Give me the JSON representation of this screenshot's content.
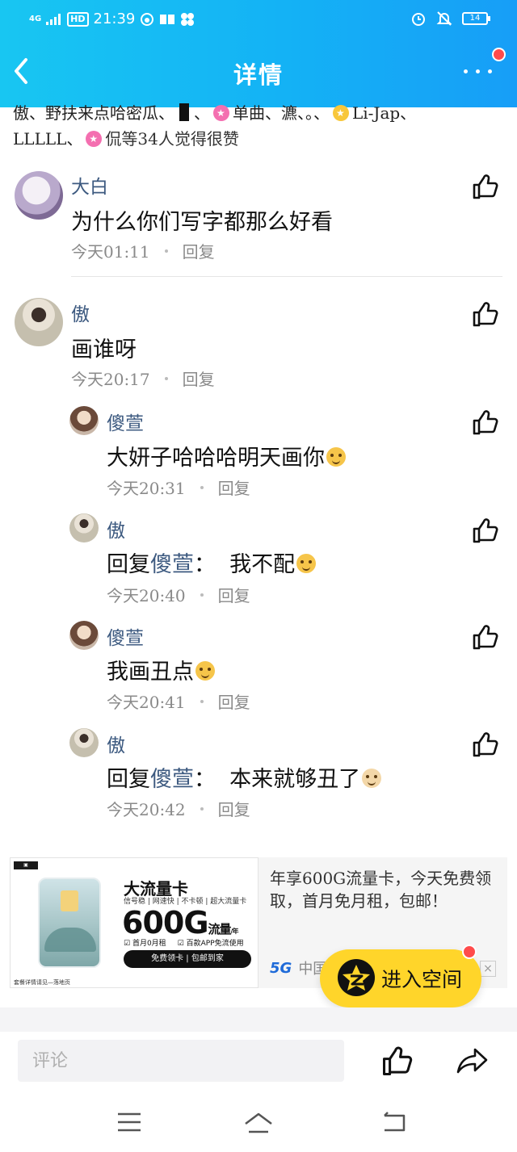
{
  "status_bar": {
    "network": "4G",
    "hd": "HD",
    "time": "21:39",
    "battery": "14"
  },
  "nav": {
    "title": "详情"
  },
  "likes": {
    "names": [
      "傲",
      "野扶来点哈密瓜",
      "",
      "单曲",
      "瀌",
      "。",
      "Li-Jap",
      "LLLLL",
      "侃"
    ],
    "line1": "傲、野扶来点哈密瓜、",
    "seg2": "、",
    "seg3": "单曲、瀌、。、",
    "seg4": "Li-Jap、",
    "line2_start": "LLLLL、",
    "summary": "侃等34人觉得很赞"
  },
  "comments": [
    {
      "name": "大白",
      "text": "为什么你们写字都那么好看",
      "time": "今天01:11",
      "reply_label": "回复",
      "avatar_color": "#d9cde6"
    },
    {
      "name": "傲",
      "text": "画谁呀",
      "time": "今天20:17",
      "reply_label": "回复",
      "avatar_color": "#c9c4b8"
    }
  ],
  "replies": [
    {
      "name": "傻萱",
      "text": "大妍子哈哈哈明天画你",
      "emoji": "dog-face-emoji",
      "time": "今天20:31",
      "reply_label": "回复"
    },
    {
      "name": "傲",
      "reply_prefix": "回复",
      "reply_to": "傻萱",
      "reply_colon": "：",
      "text": "我不配",
      "emoji": "dog-face-emoji",
      "time": "今天20:40",
      "reply_label": "回复"
    },
    {
      "name": "傻萱",
      "text": "我画丑点",
      "emoji": "dog-face-emoji",
      "time": "今天20:41",
      "reply_label": "回复"
    },
    {
      "name": "傲",
      "reply_prefix": "回复",
      "reply_to": "傻萱",
      "reply_colon": "：",
      "text": "本来就够丑了",
      "emoji": "cat-face-emoji",
      "time": "今天20:42",
      "reply_label": "回复"
    }
  ],
  "ad": {
    "card_title": "大流量卡",
    "card_features": "信号稳 | 网速快 | 不卡顿 | 超大流量卡",
    "card_big": "600G",
    "card_big_unit": "流量",
    "card_big_suffix": "/年",
    "card_check1": "首月0月租",
    "card_check2": "百款APP免流使用",
    "card_button": "免费领卡 | 包邮到家",
    "card_footer": "套餐详情请见—落地页",
    "description": "年享600G流量卡，今天免费领取，首月免月租，包邮！",
    "source_badge": "5G",
    "source": "中国",
    "close": "×"
  },
  "fab": {
    "label": "进入空间"
  },
  "bottom_bar": {
    "comment_placeholder": "评论"
  },
  "colors": {
    "header_start": "#18c6f2",
    "header_end": "#179ef7",
    "name_color": "#3d5a80",
    "fab_yellow": "#ffd52a",
    "notification_red": "#ff4b4b"
  }
}
